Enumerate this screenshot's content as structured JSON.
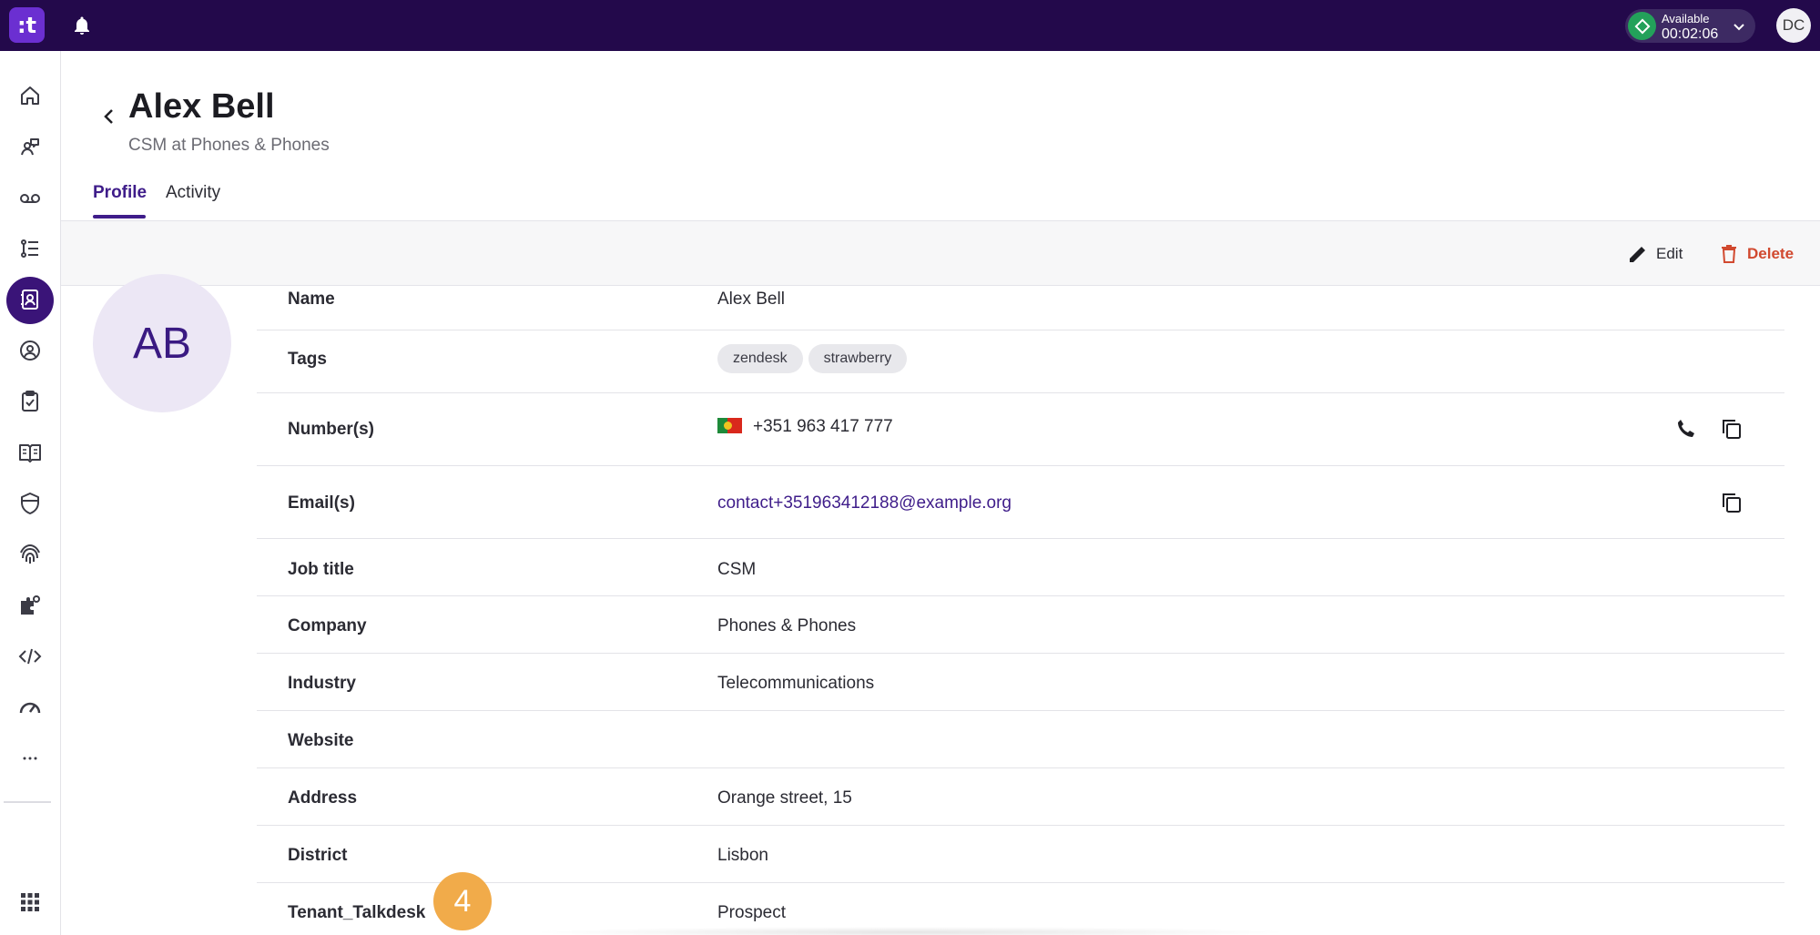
{
  "topbar": {
    "logo_text": ":t",
    "status_label": "Available",
    "status_timer": "00:02:06",
    "user_initials": "DC",
    "brand_color": "#23094b",
    "status_color": "#23a15a"
  },
  "sidebar": {
    "items": [
      {
        "icon": "home-icon",
        "active": false
      },
      {
        "icon": "conversations-icon",
        "active": false
      },
      {
        "icon": "voicemail-icon",
        "active": false
      },
      {
        "icon": "list-icon",
        "active": false
      },
      {
        "icon": "contacts-icon",
        "active": true
      },
      {
        "icon": "user-circle-icon",
        "active": false
      },
      {
        "icon": "clipboard-check-icon",
        "active": false
      },
      {
        "icon": "book-icon",
        "active": false
      },
      {
        "icon": "shield-icon",
        "active": false
      },
      {
        "icon": "fingerprint-icon",
        "active": false
      },
      {
        "icon": "puzzle-settings-icon",
        "active": false
      },
      {
        "icon": "code-icon",
        "active": false
      },
      {
        "icon": "speedometer-icon",
        "active": false
      },
      {
        "icon": "more-icon",
        "active": false
      }
    ],
    "apps_icon": "apps-grid-icon"
  },
  "header": {
    "title": "Alex Bell",
    "subtitle": "CSM at Phones & Phones",
    "tabs": [
      "Profile",
      "Activity"
    ],
    "active_tab": "Profile"
  },
  "actions": {
    "edit_label": "Edit",
    "delete_label": "Delete",
    "delete_color": "#d1492f"
  },
  "contact": {
    "initials": "AB",
    "fields": {
      "name": {
        "label": "Name",
        "value": "Alex Bell"
      },
      "tags": {
        "label": "Tags",
        "values": [
          "zendesk",
          "strawberry"
        ]
      },
      "numbers": {
        "label": "Number(s)",
        "value": "+351 963 417 777"
      },
      "emails": {
        "label": "Email(s)",
        "value": "contact+351963412188@example.org"
      },
      "job_title": {
        "label": "Job title",
        "value": "CSM"
      },
      "company": {
        "label": "Company",
        "value": "Phones & Phones"
      },
      "industry": {
        "label": "Industry",
        "value": "Telecommunications"
      },
      "website": {
        "label": "Website",
        "value": ""
      },
      "address": {
        "label": "Address",
        "value": "Orange street, 15"
      },
      "district": {
        "label": "District",
        "value": "Lisbon"
      },
      "tenant": {
        "label": "Tenant_Talkdesk",
        "value": "Prospect"
      }
    }
  },
  "step_badge": "4"
}
